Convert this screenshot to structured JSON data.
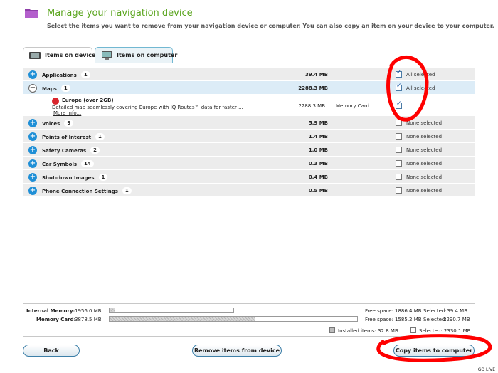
{
  "header": {
    "title": "Manage your navigation device",
    "subtitle": "Select the items you want to remove from your navigation device or computer. You can also copy an item on your device to your computer.",
    "icon": "folder-icon",
    "title_color": "#5aa51e"
  },
  "tabs": [
    {
      "label": "Items on device",
      "icon": "device-icon",
      "active": true
    },
    {
      "label": "Items on computer",
      "icon": "computer-icon",
      "active": false
    }
  ],
  "items": [
    {
      "name": "Applications",
      "count": "1",
      "size": "39.4 MB",
      "status": "All selected",
      "expanded": false,
      "checked": true
    },
    {
      "name": "Maps",
      "count": "1",
      "size": "2288.3 MB",
      "status": "All selected",
      "expanded": true,
      "checked": true,
      "children": [
        {
          "name": "Europe (over 2GB)",
          "description": "Detailed map seamlessly covering Europe with IQ Routes™ data for faster ...",
          "more": "More info...",
          "size": "2288.3 MB",
          "location": "Memory Card",
          "checked": true
        }
      ]
    },
    {
      "name": "Voices",
      "count": "9",
      "size": "5.9 MB",
      "status": "None selected",
      "expanded": false,
      "checked": false
    },
    {
      "name": "Points of Interest",
      "count": "1",
      "size": "1.4 MB",
      "status": "None selected",
      "expanded": false,
      "checked": false
    },
    {
      "name": "Safety Cameras",
      "count": "2",
      "size": "1.0 MB",
      "status": "None selected",
      "expanded": false,
      "checked": false
    },
    {
      "name": "Car Symbols",
      "count": "14",
      "size": "0.3 MB",
      "status": "None selected",
      "expanded": false,
      "checked": false
    },
    {
      "name": "Shut-down Images",
      "count": "1",
      "size": "0.4 MB",
      "status": "None selected",
      "expanded": false,
      "checked": false
    },
    {
      "name": "Phone Connection Settings",
      "count": "1",
      "size": "0.5 MB",
      "status": "None selected",
      "expanded": false,
      "checked": false
    }
  ],
  "memory": {
    "internal": {
      "label": "Internal Memory:",
      "total": "1956.0 MB",
      "free_label": "Free space:",
      "free": "1886.4 MB",
      "selected_label": "Selected:",
      "selected": "39.4 MB",
      "used_fraction": 0.04
    },
    "card": {
      "label": "Memory Card:",
      "total": "3878.5 MB",
      "free_label": "Free space:",
      "free": "1585.2 MB",
      "selected_label": "Selected:",
      "selected": "2290.7 MB",
      "used_fraction": 0.59
    },
    "legend_installed": "Installed items: 32.8 MB",
    "legend_selected": "Selected: 2330.1 MB"
  },
  "buttons": {
    "back": "Back",
    "remove": "Remove items from device",
    "copy": "Copy items to computer"
  },
  "footer": {
    "golive": "GO LIVE"
  },
  "colors": {
    "accent": "#1f8fd6",
    "selected_row": "#dcecf7",
    "annotation": "#ff0000"
  }
}
